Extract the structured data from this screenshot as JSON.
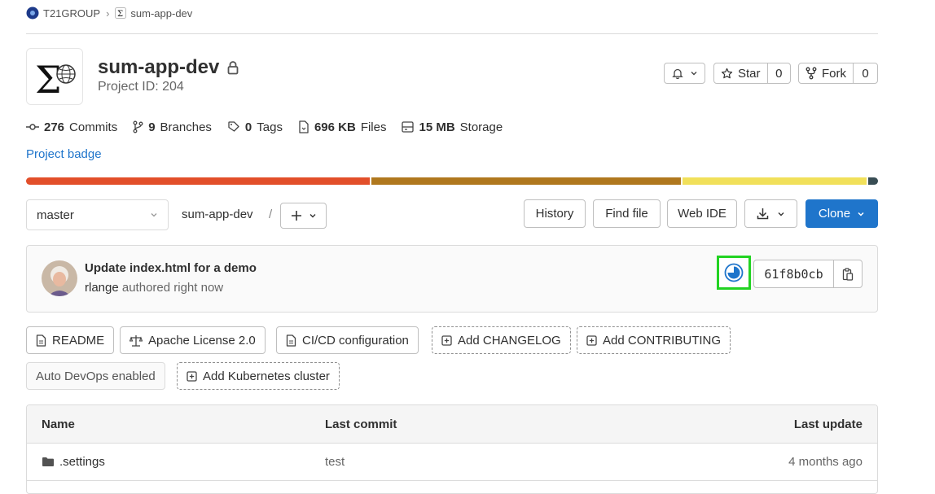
{
  "breadcrumb": {
    "group": "T21GROUP",
    "project": "sum-app-dev"
  },
  "project": {
    "title": "sum-app-dev",
    "project_id": "Project ID: 204"
  },
  "actions": {
    "star_label": "Star",
    "star_count": "0",
    "fork_label": "Fork",
    "fork_count": "0"
  },
  "stats": {
    "commits_count": "276",
    "commits_label": "Commits",
    "branches_count": "9",
    "branches_label": "Branches",
    "tags_count": "0",
    "tags_label": "Tags",
    "files_size": "696 KB",
    "files_label": "Files",
    "storage_size": "15 MB",
    "storage_label": "Storage"
  },
  "project_badge": "Project badge",
  "language_bar": [
    {
      "color": "#e24f2a"
    },
    {
      "color": "#b0781e"
    },
    {
      "color": "#f1e05a"
    },
    {
      "color": "#384d54"
    }
  ],
  "tree": {
    "branch": "master",
    "path": "sum-app-dev",
    "path_separator": "/",
    "history": "History",
    "find_file": "Find file",
    "web_ide": "Web IDE",
    "clone": "Clone"
  },
  "last_commit": {
    "title": "Update index.html for a demo",
    "author": "rlange",
    "authored": "authored right now",
    "sha": "61f8b0cb"
  },
  "quick_buttons": {
    "readme": "README",
    "license": "Apache License 2.0",
    "cicd": "CI/CD configuration",
    "changelog": "Add CHANGELOG",
    "contributing": "Add CONTRIBUTING",
    "autodevops": "Auto DevOps enabled",
    "kubernetes": "Add Kubernetes cluster"
  },
  "table": {
    "headers": {
      "name": "Name",
      "last_commit": "Last commit",
      "last_update": "Last update"
    },
    "rows": [
      {
        "name": ".settings",
        "commit": "test",
        "updated": "4 months ago"
      }
    ]
  },
  "colors": {
    "accent": "#1f75cb",
    "highlight": "#22d322"
  }
}
